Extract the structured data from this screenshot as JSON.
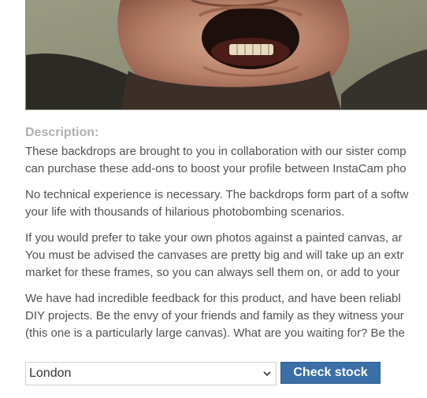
{
  "product_image": {
    "alt": "portrait-photo"
  },
  "description": {
    "heading": "Description:",
    "paragraphs": [
      [
        "These backdrops are brought to you in collaboration with our sister comp",
        "can purchase these add-ons to boost your profile between InstaCam pho"
      ],
      [
        "No technical experience is necessary. The backdrops form part of a softw",
        "your life with thousands of hilarious photobombing scenarios."
      ],
      [
        "If you would prefer to take your own photos against a painted canvas, ar",
        "You must be advised the canvases are pretty big and will take up an extr",
        "market for these frames, so you can always sell them on, or add to your"
      ],
      [
        "We have had incredible feedback for this product, and have been reliabl",
        "DIY projects. Be the envy of your friends and family as they witness your",
        "(this one is a particularly large canvas). What are you waiting for? Be the"
      ]
    ]
  },
  "stock_check": {
    "location_value": "London",
    "button_label": "Check stock"
  }
}
